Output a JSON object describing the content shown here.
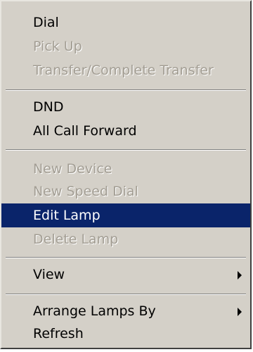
{
  "context_menu": {
    "groups": [
      {
        "items": [
          {
            "label": "Dial",
            "enabled": true
          },
          {
            "label": "Pick Up",
            "enabled": false
          },
          {
            "label": "Transfer/Complete Transfer",
            "enabled": false
          }
        ]
      },
      {
        "items": [
          {
            "label": "DND",
            "enabled": true
          },
          {
            "label": "All Call Forward",
            "enabled": true
          }
        ]
      },
      {
        "items": [
          {
            "label": "New Device",
            "enabled": false
          },
          {
            "label": "New Speed Dial",
            "enabled": false
          },
          {
            "label": "Edit Lamp",
            "enabled": true,
            "selected": true
          },
          {
            "label": "Delete Lamp",
            "enabled": false
          }
        ]
      },
      {
        "items": [
          {
            "label": "View",
            "enabled": true,
            "submenu_icon": "chevron-right-icon"
          }
        ]
      },
      {
        "items": [
          {
            "label": "Arrange Lamps By",
            "enabled": true,
            "submenu_icon": "chevron-right-icon"
          },
          {
            "label": "Refresh",
            "enabled": true
          }
        ]
      }
    ],
    "colors": {
      "background": "#d4d0c8",
      "selected_background": "#0a246a",
      "selected_text": "#ffffff",
      "disabled_text": "#a39e94"
    }
  }
}
